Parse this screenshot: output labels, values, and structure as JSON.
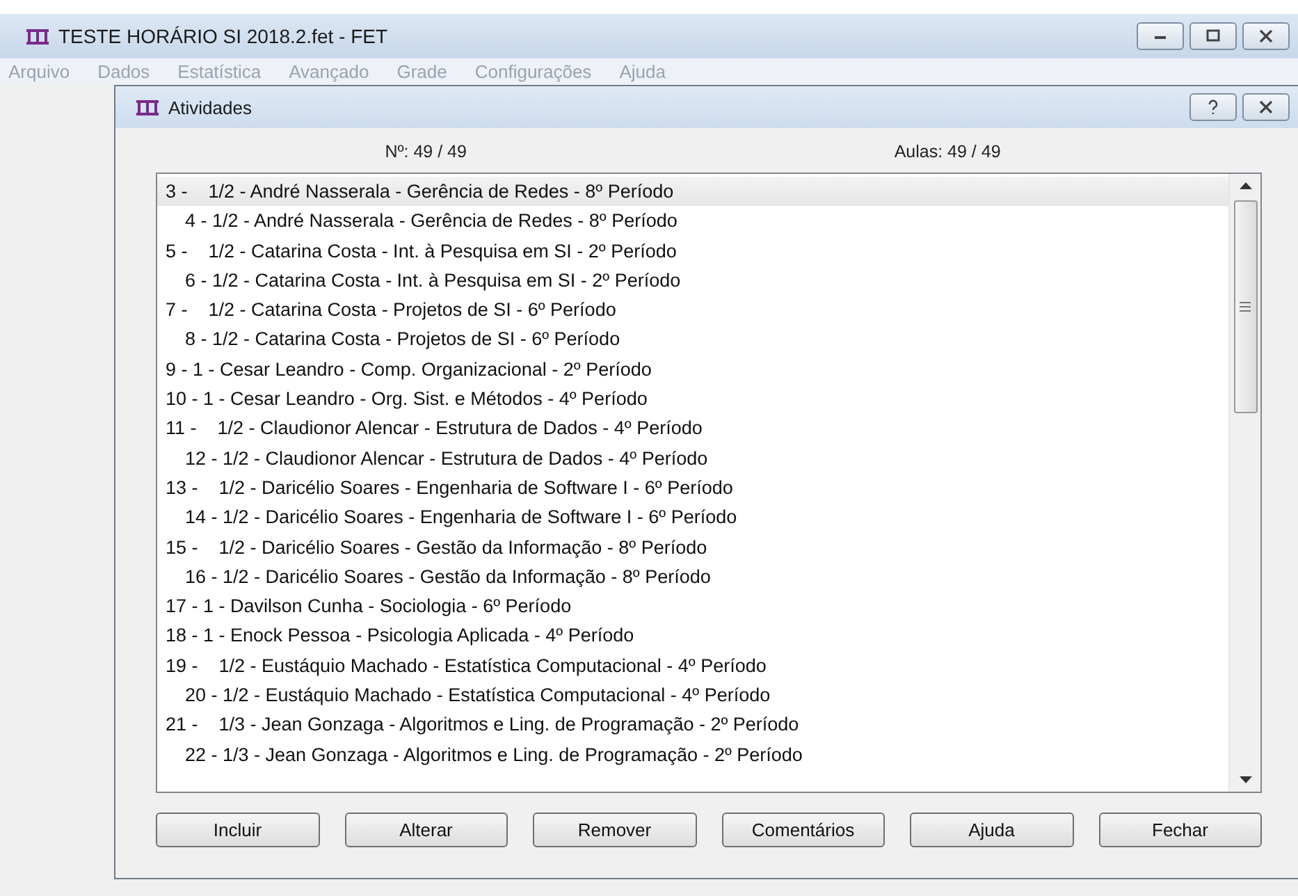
{
  "window": {
    "title": "TESTE HORÁRIO SI 2018.2.fet - FET"
  },
  "menu": [
    "Arquivo",
    "Dados",
    "Estatística",
    "Avançado",
    "Grade",
    "Configurações",
    "Ajuda"
  ],
  "dialog": {
    "title": "Atividades",
    "count": "Nº: 49 / 49",
    "lessons": "Aulas: 49 / 49",
    "rows": [
      {
        "text": "3 -    1/2 - André Nasserala - Gerência de Redes - 8º Período",
        "indented": false,
        "selected": true
      },
      {
        "text": "4 - 1/2 - André Nasserala - Gerência de Redes - 8º Período",
        "indented": true,
        "selected": false
      },
      {
        "text": "5 -    1/2 - Catarina Costa - Int. à Pesquisa em SI - 2º Período",
        "indented": false,
        "selected": false
      },
      {
        "text": "6 - 1/2 - Catarina Costa - Int. à Pesquisa em SI - 2º Período",
        "indented": true,
        "selected": false
      },
      {
        "text": "7 -    1/2 - Catarina Costa - Projetos de SI - 6º Período",
        "indented": false,
        "selected": false
      },
      {
        "text": "8 - 1/2 - Catarina Costa - Projetos de SI - 6º Período",
        "indented": true,
        "selected": false
      },
      {
        "text": "9 - 1 - Cesar Leandro - Comp. Organizacional - 2º Período",
        "indented": false,
        "selected": false
      },
      {
        "text": "10 - 1 - Cesar Leandro - Org. Sist. e Métodos - 4º Período",
        "indented": false,
        "selected": false
      },
      {
        "text": "11 -    1/2 - Claudionor Alencar - Estrutura de Dados - 4º Período",
        "indented": false,
        "selected": false
      },
      {
        "text": "12 - 1/2 - Claudionor Alencar - Estrutura de Dados - 4º Período",
        "indented": true,
        "selected": false
      },
      {
        "text": "13 -    1/2 - Daricélio Soares - Engenharia de Software I - 6º Período",
        "indented": false,
        "selected": false
      },
      {
        "text": "14 - 1/2 - Daricélio Soares - Engenharia de Software I - 6º Período",
        "indented": true,
        "selected": false
      },
      {
        "text": "15 -    1/2 - Daricélio Soares - Gestão da Informação - 8º Período",
        "indented": false,
        "selected": false
      },
      {
        "text": "16 - 1/2 - Daricélio Soares - Gestão da Informação - 8º Período",
        "indented": true,
        "selected": false
      },
      {
        "text": "17 - 1 - Davilson Cunha - Sociologia - 6º Período",
        "indented": false,
        "selected": false
      },
      {
        "text": "18 - 1 - Enock Pessoa - Psicologia Aplicada - 4º Período",
        "indented": false,
        "selected": false
      },
      {
        "text": "19 -    1/2 - Eustáquio Machado - Estatística Computacional - 4º Período",
        "indented": false,
        "selected": false
      },
      {
        "text": "20 - 1/2 - Eustáquio Machado - Estatística Computacional - 4º Período",
        "indented": true,
        "selected": false
      },
      {
        "text": "21 -    1/3 - Jean Gonzaga - Algoritmos e Ling. de Programação - 2º Período",
        "indented": false,
        "selected": false
      },
      {
        "text": "22 - 1/3 - Jean Gonzaga - Algoritmos e Ling. de Programação - 2º Período",
        "indented": true,
        "selected": false
      }
    ],
    "buttons": [
      "Incluir",
      "Alterar",
      "Remover",
      "Comentários",
      "Ajuda",
      "Fechar"
    ]
  }
}
